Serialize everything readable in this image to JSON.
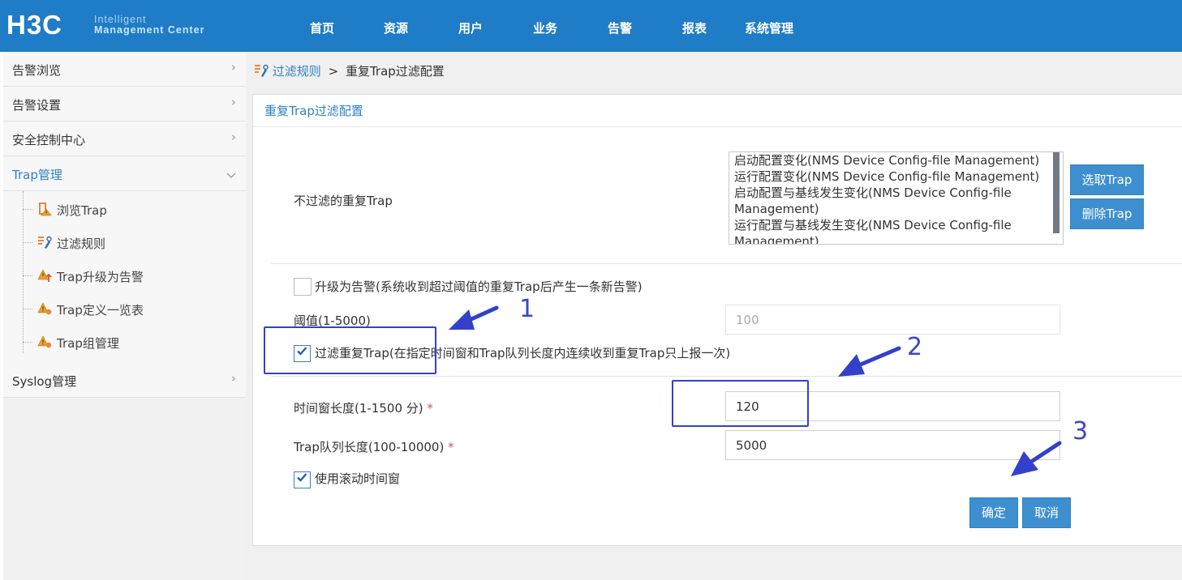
{
  "header": {
    "logo": "H3C",
    "logo_sub_line1": "Intelligent",
    "logo_sub_line2_a": "Management",
    "logo_sub_line2_b": "Center",
    "nav": [
      "首页",
      "资源",
      "用户",
      "业务",
      "告警",
      "报表",
      "系统管理"
    ],
    "bar_color": "#1f7cc7"
  },
  "sidebar": {
    "groups": [
      {
        "label": "告警浏览",
        "chevron": ">"
      },
      {
        "label": "告警设置",
        "chevron": ">"
      },
      {
        "label": "安全控制中心",
        "chevron": ">"
      },
      {
        "label": "Trap管理",
        "chevron": "expanded"
      }
    ],
    "trap_items": [
      {
        "label": "浏览Trap",
        "icon": "browse-trap-icon"
      },
      {
        "label": "过滤规则",
        "icon": "filter-rule-icon"
      },
      {
        "label": "Trap升级为告警",
        "icon": "upgrade-alarm-icon"
      },
      {
        "label": "Trap定义一览表",
        "icon": "warning-icon"
      },
      {
        "label": "Trap组管理",
        "icon": "warning-icon"
      }
    ],
    "syslog": {
      "label": "Syslog管理",
      "chevron": ">"
    }
  },
  "breadcrumb": {
    "link": "过滤规则",
    "separator": ">",
    "current": "重复Trap过滤配置"
  },
  "panel": {
    "title": "重复Trap过滤配置",
    "unfiltered_label": "不过滤的重复Trap",
    "unfiltered_list": [
      "启动配置变化(NMS Device Config-file Management)",
      "运行配置变化(NMS Device Config-file Management)",
      "启动配置与基线发生变化(NMS Device Config-file Management)",
      "运行配置与基线发生变化(NMS Device Config-file Management)"
    ],
    "select_button": "选取Trap",
    "delete_button": "删除Trap",
    "upgrade_checkbox": {
      "label": "升级为告警(系统收到超过阈值的重复Trap后产生一条新告警)",
      "checked": false
    },
    "threshold": {
      "label": "阈值(1-5000)",
      "value": "100",
      "disabled": true
    },
    "filter_checkbox": {
      "label": "过滤重复Trap(在指定时间窗和Trap队列长度内连续收到重复Trap只上报一次)",
      "checked": true
    },
    "time_window": {
      "label": "时间窗长度(1-1500 分)",
      "required_mark": "*",
      "value": "120"
    },
    "queue_length": {
      "label": "Trap队列长度(100-10000)",
      "required_mark": "*",
      "value": "5000"
    },
    "rolling_checkbox": {
      "label": "使用滚动时间窗",
      "checked": true
    },
    "ok_button": "确定",
    "cancel_button": "取消"
  },
  "annotations": {
    "numbers": [
      "1",
      "2",
      "3"
    ],
    "color": "#3340cc"
  }
}
